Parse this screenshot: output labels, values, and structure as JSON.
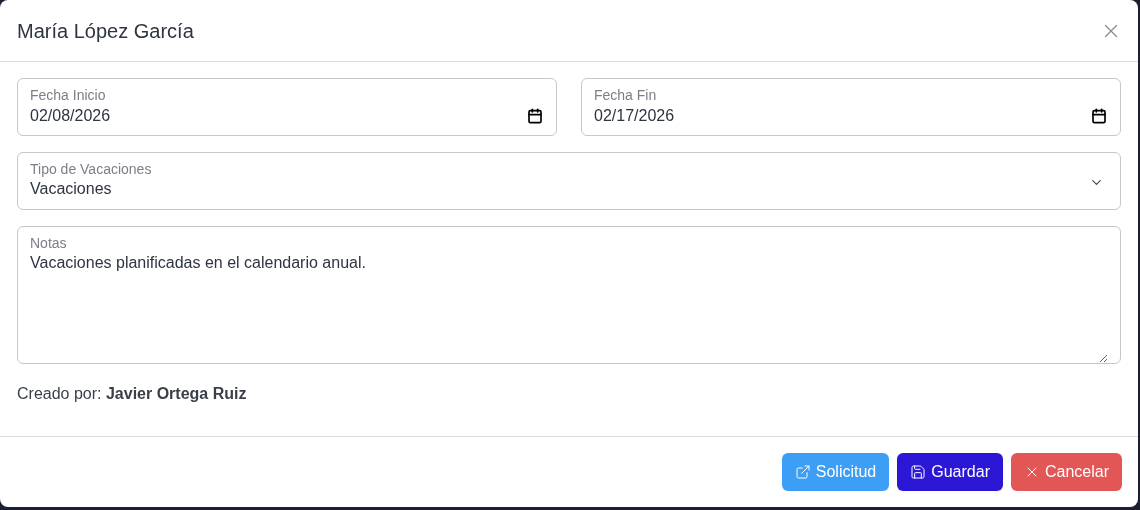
{
  "dialog": {
    "title": "María López García"
  },
  "fields": [
    {
      "kind": "date",
      "label": "Fecha Inicio",
      "value": "02/08/2026"
    },
    {
      "kind": "date",
      "label": "Fecha Fin",
      "value": "02/17/2026"
    },
    {
      "kind": "select",
      "label": "Tipo de Vacaciones",
      "value": "Vacaciones"
    },
    {
      "kind": "textarea",
      "label": "Notas",
      "value": "Vacaciones planificadas en el calendario anual."
    }
  ],
  "created_by": "Creado por: **Javier Ortega Ruiz**",
  "buttons": [
    {
      "kind": "link",
      "label": "Solicitud"
    },
    {
      "kind": "save",
      "label": "Guardar"
    },
    {
      "kind": "cancel",
      "label": "Cancelar"
    }
  ]
}
